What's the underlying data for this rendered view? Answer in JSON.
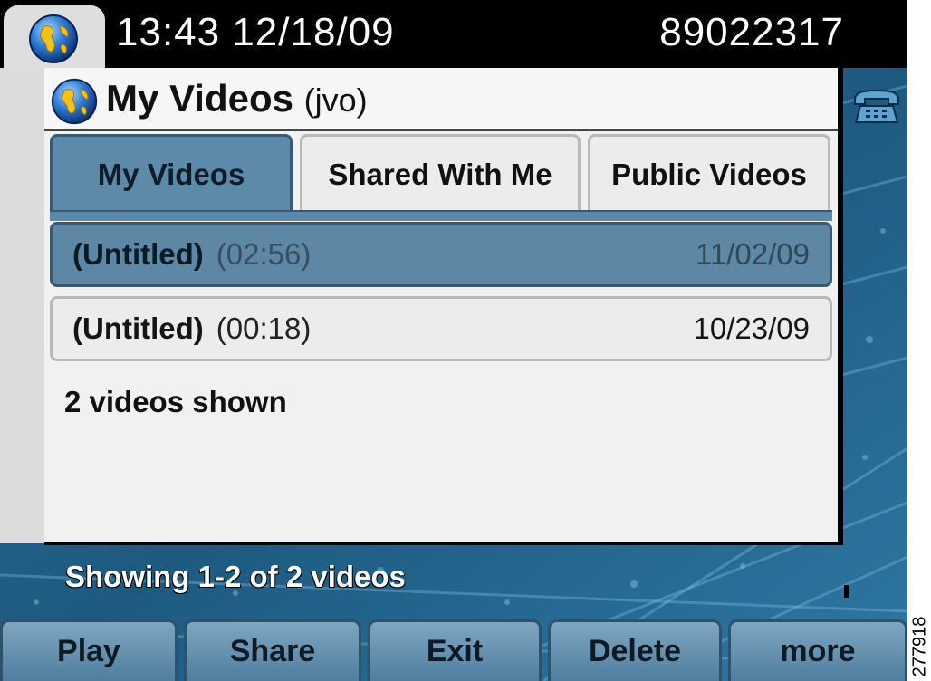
{
  "status_bar": {
    "time_date": "13:43 12/18/09",
    "extension": "89022317"
  },
  "app": {
    "title": "My Videos",
    "title_suffix": "(jvo)",
    "tabs": [
      {
        "label": "My Videos",
        "active": true
      },
      {
        "label": "Shared With Me",
        "active": false
      },
      {
        "label": "Public Videos",
        "active": false
      }
    ],
    "videos": [
      {
        "title": "(Untitled)",
        "duration": "(02:56)",
        "date": "11/02/09",
        "selected": true
      },
      {
        "title": "(Untitled)",
        "duration": "(00:18)",
        "date": "10/23/09",
        "selected": false
      }
    ],
    "count_text": "2 videos shown"
  },
  "status_message": "Showing 1-2 of 2 videos",
  "softkeys": [
    "Play",
    "Share",
    "Exit",
    "Delete",
    "more"
  ],
  "figure_number": "277918",
  "icons": {
    "status_app_icon": "globe-icon",
    "title_app_icon": "globe-icon",
    "line_icon": "phone-icon"
  },
  "colors": {
    "accent": "#5d8aa8",
    "background": "#1f5f86",
    "status_bar": "#000000"
  }
}
